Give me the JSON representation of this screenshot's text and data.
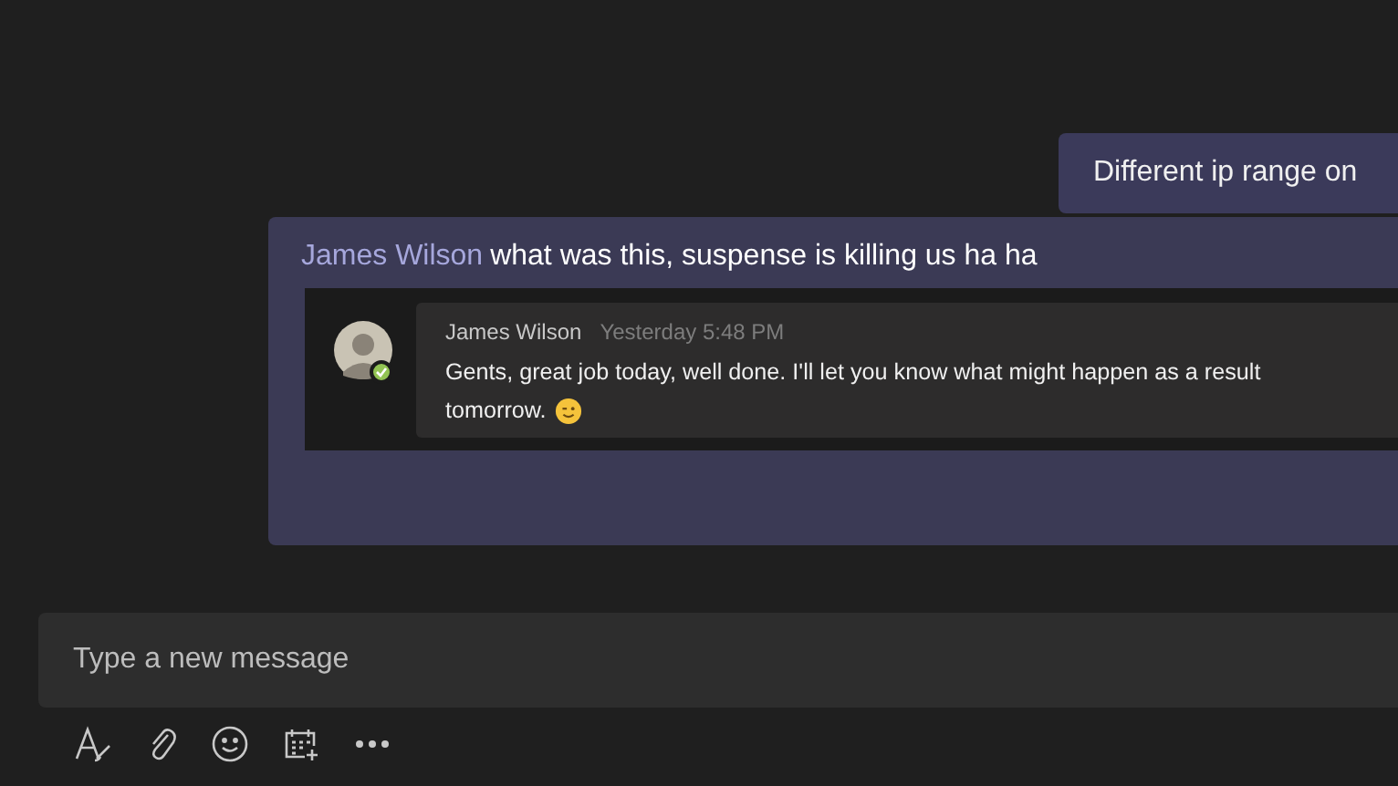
{
  "outgoing_message": {
    "text": "Different ip range on"
  },
  "reply_message": {
    "author": "James Wilson",
    "text": "what was this, suspense is killing us ha ha",
    "quoted": {
      "author": "James Wilson",
      "time": "Yesterday 5:48 PM",
      "line_1": "Gents, great job today, well done. I'll let you know what might happen as a result",
      "line_2": "tomorrow.",
      "online": true
    }
  },
  "compose": {
    "placeholder": "Type a new message"
  },
  "toolbar": [
    {
      "kind": "format"
    },
    {
      "kind": "attach"
    },
    {
      "kind": "emoji"
    },
    {
      "kind": "schedule"
    },
    {
      "kind": "more"
    }
  ]
}
